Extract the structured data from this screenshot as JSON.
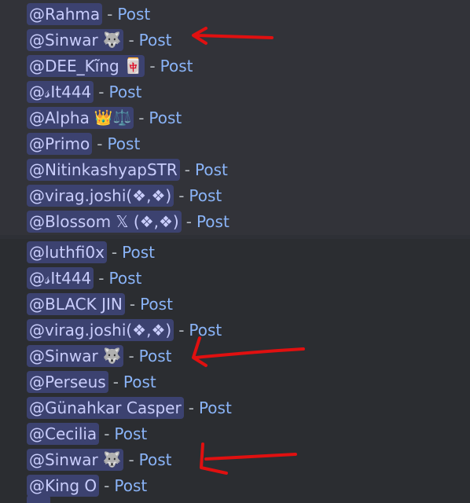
{
  "separator": "-",
  "post_label": "Post",
  "rows_top": [
    {
      "name": "@Rahma",
      "emoji": ""
    },
    {
      "name": "@Sinwar",
      "emoji": "🐺"
    },
    {
      "name": "@DEE_Kĩng",
      "emoji": "🀄"
    },
    {
      "name": "@𝓈It444",
      "emoji": ""
    },
    {
      "name": "@Alpha",
      "emoji": "👑⚖️"
    },
    {
      "name": "@Primo",
      "emoji": ""
    },
    {
      "name": "@NitinkashyapSTR",
      "emoji": ""
    },
    {
      "name": "@virag.joshi(❖,❖)",
      "emoji": ""
    },
    {
      "name": "@Blossom 𝕏 (❖,❖)",
      "emoji": ""
    }
  ],
  "rows_bottom": [
    {
      "name": "@luthfi0x",
      "emoji": ""
    },
    {
      "name": "@𝓈It444",
      "emoji": ""
    },
    {
      "name": "@BLACK JIN",
      "emoji": ""
    },
    {
      "name": "@virag.joshi(❖,❖)",
      "emoji": ""
    },
    {
      "name": "@Sinwar",
      "emoji": "🐺"
    },
    {
      "name": "@Perseus",
      "emoji": ""
    },
    {
      "name": "@Günahkar Casper",
      "emoji": ""
    },
    {
      "name": "@Cecilia",
      "emoji": ""
    },
    {
      "name": "@Sinwar",
      "emoji": "🐺"
    },
    {
      "name": "@King O",
      "emoji": ""
    }
  ],
  "colors": {
    "mention_bg": "#3c4270",
    "mention_text": "#c9cdfb",
    "link": "#8ab4f8",
    "annotation_arrow": "#e01010"
  }
}
